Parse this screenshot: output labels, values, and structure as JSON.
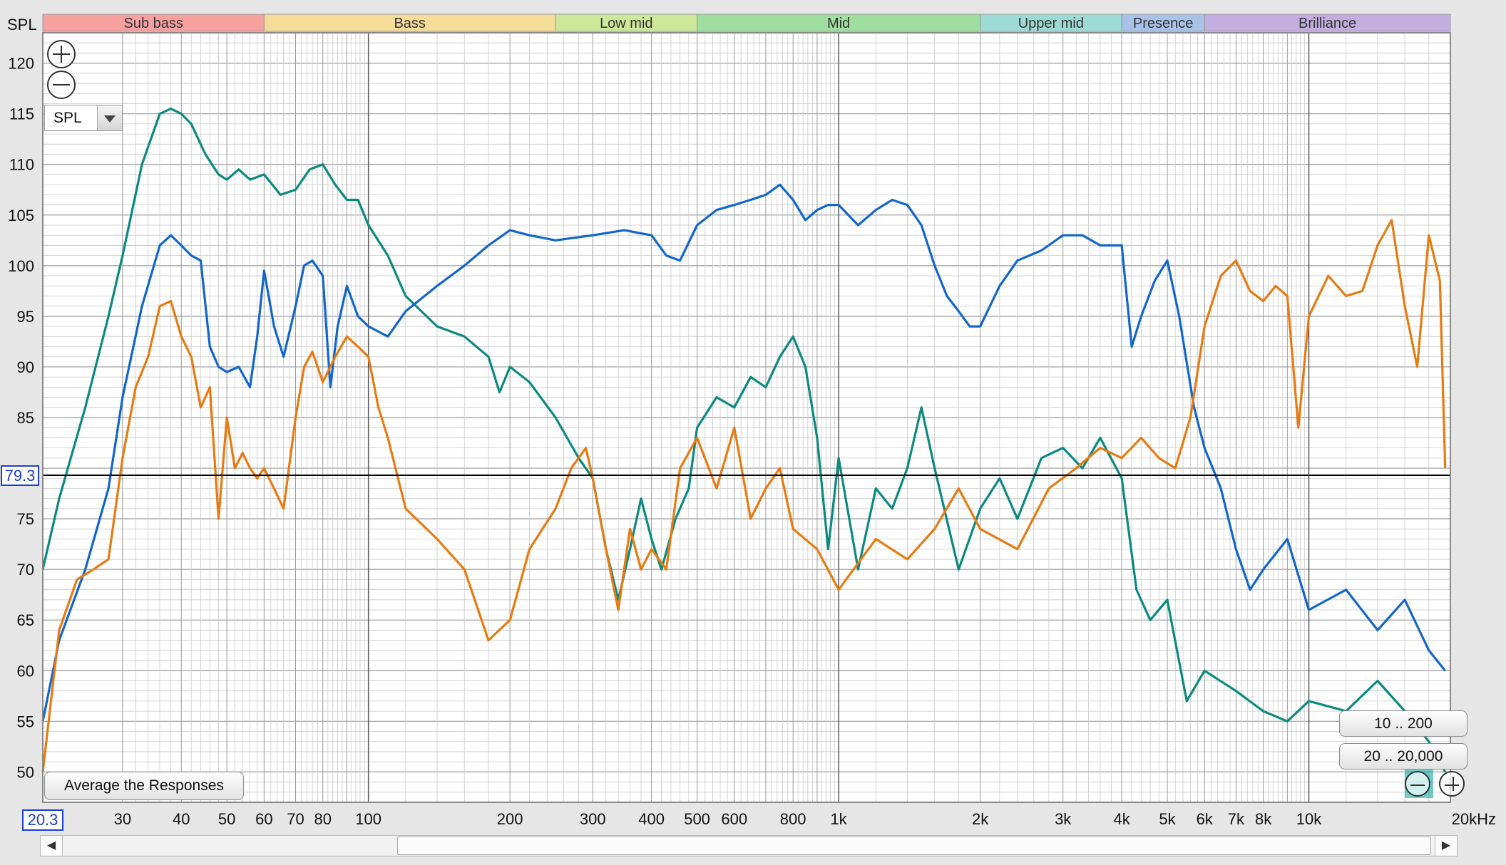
{
  "chart_data": {
    "type": "line",
    "ylabel": "SPL",
    "xlabel": "",
    "x_scale": "log",
    "xlim": [
      20.3,
      20000
    ],
    "ylim": [
      47,
      123
    ],
    "y_ticks": [
      50,
      55,
      60,
      65,
      70,
      75,
      85,
      90,
      95,
      100,
      105,
      110,
      115,
      120
    ],
    "x_ticks": [
      {
        "v": 30,
        "label": "30"
      },
      {
        "v": 40,
        "label": "40"
      },
      {
        "v": 50,
        "label": "50"
      },
      {
        "v": 60,
        "label": "60"
      },
      {
        "v": 70,
        "label": "70"
      },
      {
        "v": 80,
        "label": "80"
      },
      {
        "v": 100,
        "label": "100"
      },
      {
        "v": 200,
        "label": "200"
      },
      {
        "v": 300,
        "label": "300"
      },
      {
        "v": 400,
        "label": "400"
      },
      {
        "v": 500,
        "label": "500"
      },
      {
        "v": 600,
        "label": "600"
      },
      {
        "v": 800,
        "label": "800"
      },
      {
        "v": 1000,
        "label": "1k"
      },
      {
        "v": 2000,
        "label": "2k"
      },
      {
        "v": 3000,
        "label": "3k"
      },
      {
        "v": 4000,
        "label": "4k"
      },
      {
        "v": 5000,
        "label": "5k"
      },
      {
        "v": 6000,
        "label": "6k"
      },
      {
        "v": 7000,
        "label": "7k"
      },
      {
        "v": 8000,
        "label": "8k"
      },
      {
        "v": 10000,
        "label": "10k"
      },
      {
        "v": 20000,
        "label": "20kHz"
      }
    ],
    "bands": [
      {
        "name": "Sub bass",
        "from": 20.3,
        "to": 60,
        "color": "#f7a0a0"
      },
      {
        "name": "Bass",
        "from": 60,
        "to": 250,
        "color": "#f5dc9a"
      },
      {
        "name": "Low mid",
        "from": 250,
        "to": 500,
        "color": "#cde89a"
      },
      {
        "name": "Mid",
        "from": 500,
        "to": 2000,
        "color": "#a0dea0"
      },
      {
        "name": "Upper mid",
        "from": 2000,
        "to": 4000,
        "color": "#9ddad3"
      },
      {
        "name": "Presence",
        "from": 4000,
        "to": 6000,
        "color": "#a9c2e8"
      },
      {
        "name": "Brilliance",
        "from": 6000,
        "to": 20000,
        "color": "#c4aee0"
      }
    ],
    "cursor": {
      "y": 79.3,
      "label": "79.3"
    },
    "grid": true,
    "series": [
      {
        "color": "#0a8a80",
        "x": [
          20.3,
          22,
          25,
          28,
          30,
          33,
          36,
          38,
          40,
          42,
          45,
          48,
          50,
          53,
          56,
          60,
          65,
          70,
          75,
          80,
          85,
          90,
          95,
          100,
          110,
          120,
          140,
          160,
          180,
          190,
          200,
          220,
          250,
          280,
          300,
          320,
          340,
          360,
          380,
          400,
          420,
          450,
          480,
          500,
          550,
          600,
          650,
          700,
          750,
          800,
          850,
          900,
          950,
          1000,
          1100,
          1200,
          1300,
          1400,
          1500,
          1600,
          1800,
          2000,
          2200,
          2400,
          2700,
          3000,
          3300,
          3600,
          4000,
          4300,
          4600,
          5000,
          5500,
          6000,
          7000,
          8000,
          9000,
          10000,
          12000,
          14000,
          16000,
          18000,
          19500
        ],
        "y": [
          70,
          77,
          86,
          95,
          101,
          110,
          115,
          115.5,
          115,
          114,
          111,
          109,
          108.5,
          109.5,
          108.5,
          109,
          107,
          107.5,
          109.5,
          110,
          108,
          106.5,
          106.5,
          104,
          101,
          97,
          94,
          93,
          91,
          87.5,
          90,
          88.5,
          85,
          81,
          79,
          72,
          67,
          72,
          77,
          73,
          70,
          75,
          78,
          84,
          87,
          86,
          89,
          88,
          91,
          93,
          90,
          83,
          72,
          81,
          70,
          78,
          76,
          80,
          86,
          80,
          70,
          76,
          79,
          75,
          81,
          82,
          80,
          83,
          79,
          68,
          65,
          67,
          57,
          60,
          58,
          56,
          55,
          57,
          56,
          59,
          56,
          53,
          50
        ]
      },
      {
        "color": "#1166cc",
        "x": [
          20.3,
          22,
          25,
          28,
          30,
          33,
          36,
          38,
          40,
          42,
          44,
          46,
          48,
          50,
          53,
          56,
          58,
          60,
          63,
          66,
          70,
          73,
          76,
          80,
          83,
          86,
          90,
          95,
          100,
          110,
          120,
          140,
          160,
          180,
          200,
          220,
          250,
          300,
          350,
          400,
          430,
          460,
          500,
          550,
          600,
          650,
          700,
          750,
          800,
          850,
          900,
          950,
          1000,
          1100,
          1200,
          1300,
          1400,
          1500,
          1600,
          1700,
          1800,
          1900,
          2000,
          2200,
          2400,
          2700,
          3000,
          3300,
          3600,
          4000,
          4200,
          4400,
          4700,
          5000,
          5300,
          5700,
          6000,
          6500,
          7000,
          7500,
          8000,
          9000,
          10000,
          12000,
          14000,
          16000,
          18000,
          19500
        ],
        "y": [
          55,
          63,
          70,
          78,
          87,
          96,
          102,
          103,
          102,
          101,
          100.5,
          92,
          90,
          89.5,
          90,
          88,
          93,
          99.5,
          94,
          91,
          96,
          100,
          100.5,
          99,
          88,
          94,
          98,
          95,
          94,
          93,
          95.5,
          98,
          100,
          102,
          103.5,
          103,
          102.5,
          103,
          103.5,
          103,
          101,
          100.5,
          104,
          105.5,
          106,
          106.5,
          107,
          108,
          106.5,
          104.5,
          105.5,
          106,
          106,
          104,
          105.5,
          106.5,
          106,
          104,
          100,
          97,
          95.5,
          94,
          94,
          98,
          100.5,
          101.5,
          103,
          103,
          102,
          102,
          92,
          95,
          98.5,
          100.5,
          95,
          86,
          82,
          78,
          72,
          68,
          70,
          73,
          66,
          68,
          64,
          67,
          62,
          60
        ]
      },
      {
        "color": "#e87a10",
        "x": [
          20.3,
          22,
          24,
          26,
          28,
          30,
          32,
          34,
          36,
          38,
          40,
          42,
          44,
          46,
          48,
          50,
          52,
          54,
          56,
          58,
          60,
          63,
          66,
          70,
          73,
          76,
          80,
          85,
          90,
          95,
          100,
          105,
          110,
          120,
          140,
          160,
          180,
          200,
          220,
          250,
          270,
          290,
          300,
          320,
          340,
          360,
          380,
          400,
          430,
          460,
          500,
          550,
          600,
          650,
          700,
          750,
          800,
          900,
          1000,
          1200,
          1400,
          1600,
          1800,
          2000,
          2400,
          2800,
          3200,
          3600,
          4000,
          4400,
          4800,
          5200,
          5600,
          6000,
          6500,
          7000,
          7500,
          8000,
          8500,
          9000,
          9500,
          10000,
          11000,
          12000,
          13000,
          14000,
          15000,
          16000,
          17000,
          18000,
          19000,
          19500
        ],
        "y": [
          50,
          64,
          69,
          70,
          71,
          81,
          88,
          91,
          96,
          96.5,
          93,
          91,
          86,
          88,
          75,
          85,
          80,
          81.5,
          80,
          79,
          80,
          78,
          76,
          85,
          90,
          91.5,
          88.5,
          91,
          93,
          92,
          91,
          86,
          83,
          76,
          73,
          70,
          63,
          65,
          72,
          76,
          80,
          82,
          79,
          72,
          66,
          74,
          70,
          72,
          70,
          80,
          83,
          78,
          84,
          75,
          78,
          80,
          74,
          72,
          68,
          73,
          71,
          74,
          78,
          74,
          72,
          78,
          80,
          82,
          81,
          83,
          81,
          80,
          85,
          94,
          99,
          100.5,
          97.5,
          96.5,
          98,
          97,
          84,
          95,
          99,
          97,
          97.5,
          102,
          104.5,
          96,
          90,
          103,
          98.5,
          80
        ]
      }
    ]
  },
  "axis_title": "SPL",
  "cursor_label": "79.3",
  "xmin_label": "20.3",
  "controls": {
    "select_value": "SPL",
    "average_button": "Average the Responses",
    "range1_button": "10 .. 200",
    "range2_button": "20 .. 20,000"
  },
  "scroll": {
    "left_arrow": "◀",
    "right_arrow": "▶"
  },
  "colors": {
    "grid_major": "#9a9a9a",
    "grid_minor": "#c9c9c9",
    "plot_bg": "#ffffff",
    "cursor_line": "#000000",
    "accent_label": "#1a3fd6"
  }
}
